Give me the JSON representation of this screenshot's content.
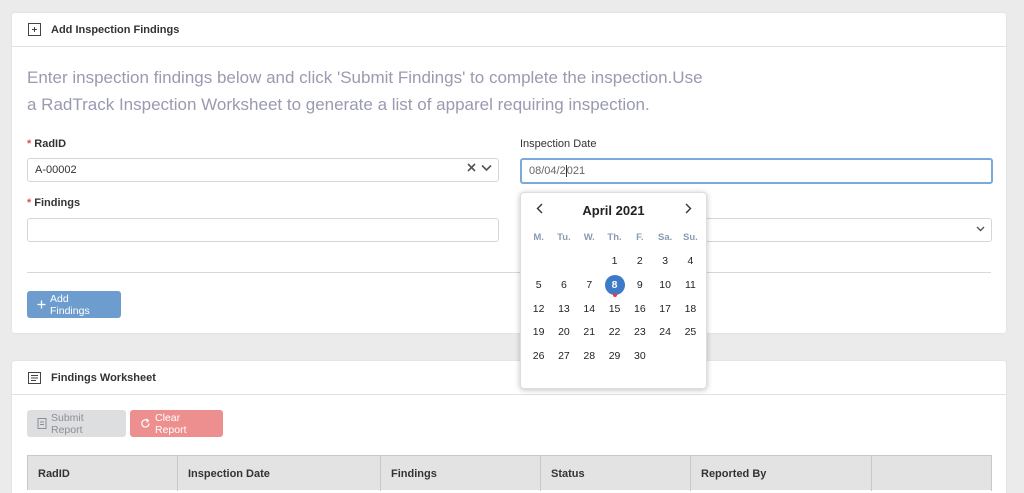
{
  "add_card": {
    "title": "Add Inspection Findings",
    "icon": "add-note-icon",
    "intro_line1": "Enter inspection findings below and click 'Submit Findings' to complete the inspection.Use",
    "intro_line2": "a RadTrack Inspection Worksheet to generate a list of apparel requiring inspection.",
    "radid": {
      "label": "RadID",
      "value": "A-00002"
    },
    "inspection_date": {
      "label": "Inspection Date",
      "value_before_caret": "08/04/2",
      "value_after_caret": "021"
    },
    "findings": {
      "label": "Findings",
      "value": ""
    },
    "add_button": "Add Findings",
    "required_mark": "*"
  },
  "calendar": {
    "month_title": "April 2021",
    "weekdays": [
      "M.",
      "Tu.",
      "W.",
      "Th.",
      "F.",
      "Sa.",
      "Su."
    ],
    "leading_blanks": 3,
    "days": [
      "1",
      "2",
      "3",
      "4",
      "5",
      "6",
      "7",
      "8",
      "9",
      "10",
      "11",
      "12",
      "13",
      "14",
      "15",
      "16",
      "17",
      "18",
      "19",
      "20",
      "21",
      "22",
      "23",
      "24",
      "25",
      "26",
      "27",
      "28",
      "29",
      "30"
    ],
    "selected_day": "8",
    "accent": "#3d7ac8"
  },
  "worksheet_card": {
    "title": "Findings Worksheet",
    "icon": "list-icon",
    "submit_button": "Submit Report",
    "clear_button": "Clear Report",
    "columns": [
      "RadID",
      "Inspection Date",
      "Findings",
      "Status",
      "Reported By",
      ""
    ]
  },
  "colors": {
    "primary": "#6d9dcf",
    "danger": "#ee8f8f",
    "required": "#d9534f"
  }
}
